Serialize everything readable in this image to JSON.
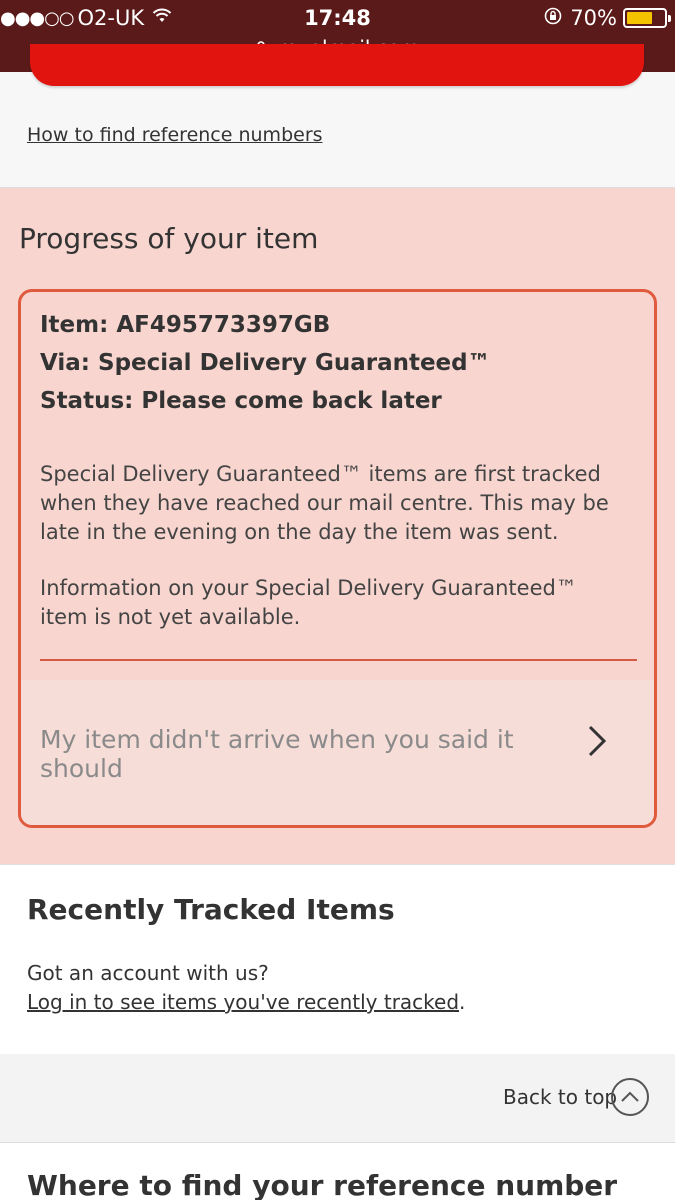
{
  "status_bar": {
    "signal": "●●●○○",
    "carrier": "O2-UK",
    "wifi_icon": "wifi-icon",
    "time": "17:48",
    "battery_percent": "70%",
    "battery_level": 0.7,
    "url": "royalmail.com"
  },
  "top": {
    "reference_link": "How to find reference numbers"
  },
  "progress": {
    "title": "Progress of your item",
    "item_line": "Item: AF495773397GB",
    "via_line": "Via: Special Delivery Guaranteed™",
    "status_line": "Status: Please come back later",
    "description_1": "Special Delivery Guaranteed™ items are first tracked when they have reached our mail centre. This may be late in the evening on the day the item was sent.",
    "description_2": "Information on your Special Delivery Guaranteed™ item is not yet available.",
    "didnt_arrive_label": "My item didn't arrive when you said it should"
  },
  "recent": {
    "title": "Recently Tracked Items",
    "question": "Got an account with us?",
    "login_link": "Log in to see items you've recently tracked",
    "login_suffix": "."
  },
  "back_to_top": {
    "label": "Back to top"
  },
  "where": {
    "title": "Where to find your reference number"
  },
  "colors": {
    "brand_red": "#e1140f",
    "panel_pink": "#f8d6cf",
    "card_border": "#e05a3d",
    "status_bar": "#5b1a1a"
  }
}
